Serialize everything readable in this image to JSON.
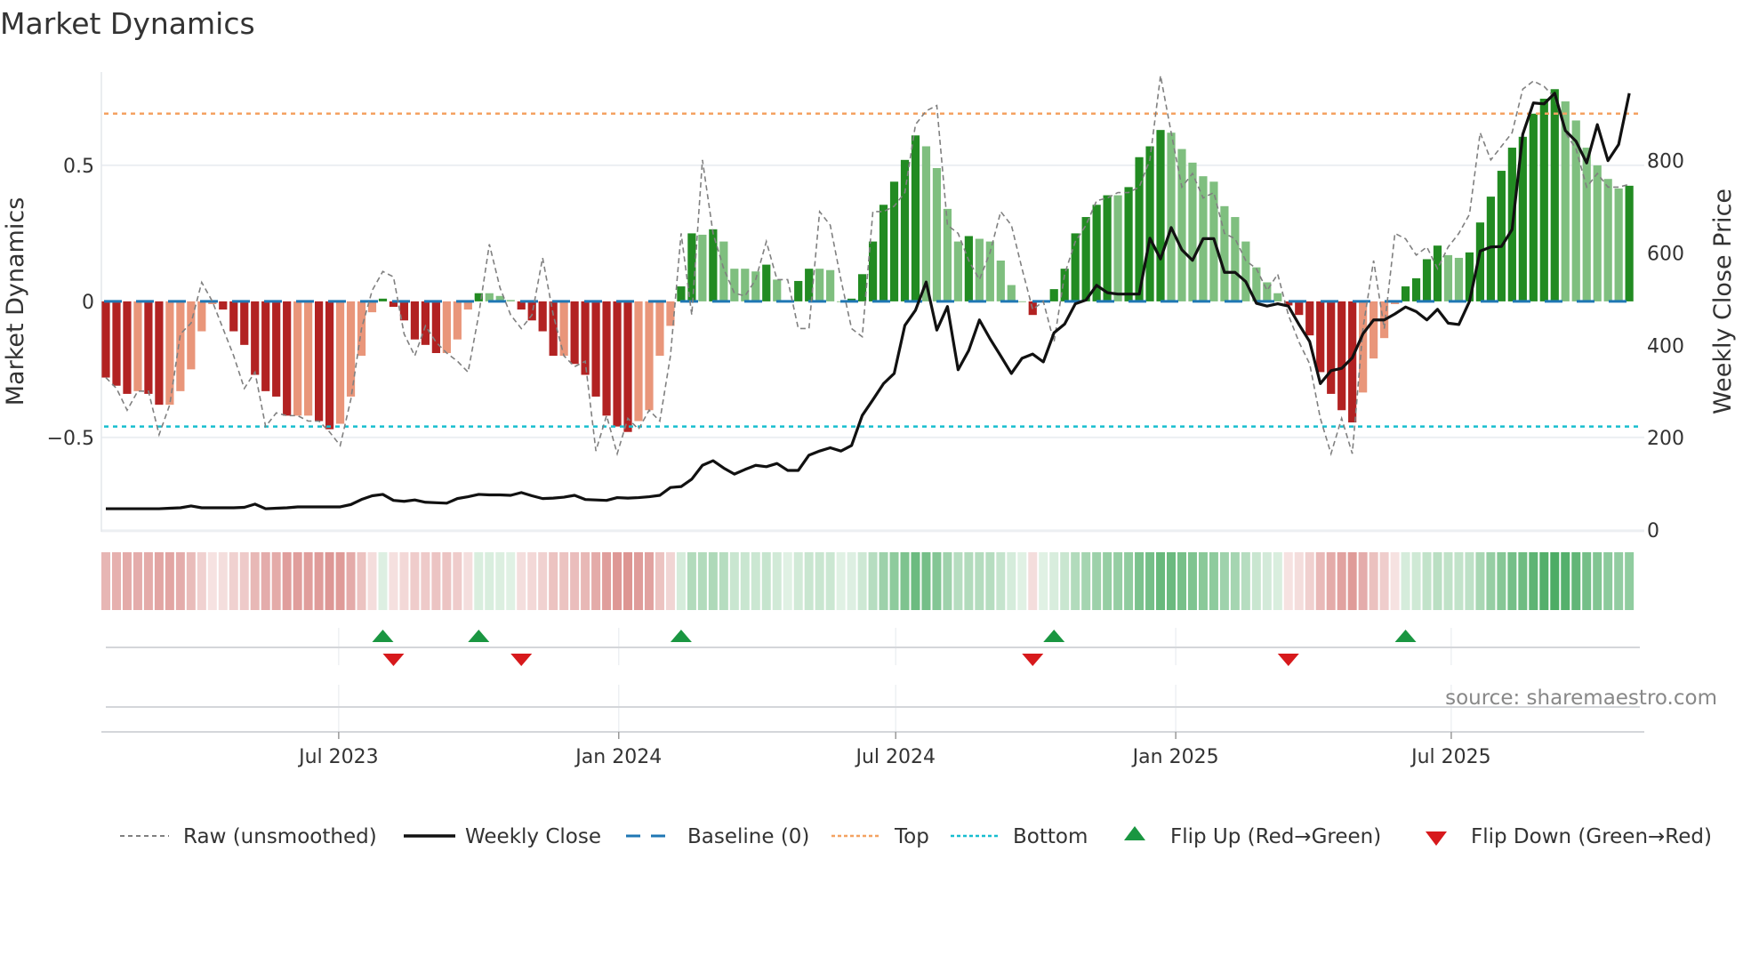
{
  "title": "Market Dynamics",
  "source": "source: sharemaestro.com",
  "colors": {
    "dark_red": "#b22222",
    "light_red": "#e9967a",
    "dark_green": "#228b22",
    "light_green": "#7fbf7f",
    "raw": "#808080",
    "close": "#111111",
    "baseline": "#1f77b4",
    "top": "#f4a261",
    "bottom": "#17becf",
    "flip_up": "#1a9641",
    "flip_down": "#d7191c"
  },
  "chart_data": {
    "type": "bar",
    "title": "Market Dynamics",
    "ylabel": "Market Dynamics",
    "y2label": "Weekly Close Price",
    "ylim": [
      -0.847,
      0.843
    ],
    "y2lim": [
      -4,
      992
    ],
    "yticks": [
      {
        "value": -0.5,
        "label": "−0.5"
      },
      {
        "value": 0,
        "label": "0"
      },
      {
        "value": 0.5,
        "label": "0.5"
      }
    ],
    "y2ticks": [
      {
        "value": 0,
        "label": "0"
      },
      {
        "value": 200,
        "label": "200"
      },
      {
        "value": 400,
        "label": "400"
      },
      {
        "value": 600,
        "label": "600"
      },
      {
        "value": 800,
        "label": "800"
      }
    ],
    "xticks": [
      {
        "date": "2023-07-01",
        "label": "Jul 2023"
      },
      {
        "date": "2024-01-01",
        "label": "Jan 2024"
      },
      {
        "date": "2024-07-01",
        "label": "Jul 2024"
      },
      {
        "date": "2025-01-01",
        "label": "Jan 2025"
      },
      {
        "date": "2025-07-01",
        "label": "Jul 2025"
      }
    ],
    "start_date": "2023-01-29",
    "frequency": "weekly",
    "baseline": 0,
    "top": 0.69,
    "bottom": -0.46,
    "series": [
      {
        "name": "Market Dynamics",
        "values": [
          -0.28,
          -0.31,
          -0.34,
          -0.33,
          -0.34,
          -0.38,
          -0.38,
          -0.33,
          -0.25,
          -0.11,
          -0.01,
          -0.03,
          -0.11,
          -0.16,
          -0.27,
          -0.33,
          -0.35,
          -0.42,
          -0.42,
          -0.42,
          -0.44,
          -0.47,
          -0.45,
          -0.35,
          -0.2,
          -0.04,
          0.01,
          -0.02,
          -0.07,
          -0.14,
          -0.16,
          -0.19,
          -0.19,
          -0.14,
          -0.03,
          0.03,
          0.03,
          0.02,
          0.005,
          -0.03,
          -0.07,
          -0.11,
          -0.2,
          -0.2,
          -0.23,
          -0.27,
          -0.35,
          -0.42,
          -0.46,
          -0.48,
          -0.44,
          -0.4,
          -0.2,
          -0.09,
          0.055,
          0.25,
          0.245,
          0.265,
          0.22,
          0.12,
          0.12,
          0.11,
          0.135,
          0.08,
          0,
          0.075,
          0.12,
          0.12,
          0.115,
          0,
          0.01,
          0.1,
          0.22,
          0.355,
          0.44,
          0.52,
          0.61,
          0.57,
          0.49,
          0.34,
          0.22,
          0.24,
          0.23,
          0.22,
          0.15,
          0.06,
          0,
          -0.05,
          0,
          0.045,
          0.12,
          0.25,
          0.31,
          0.355,
          0.39,
          0.39,
          0.42,
          0.53,
          0.57,
          0.63,
          0.62,
          0.56,
          0.51,
          0.46,
          0.44,
          0.35,
          0.31,
          0.22,
          0.125,
          0.07,
          0.03,
          -0.015,
          -0.05,
          -0.125,
          -0.26,
          -0.34,
          -0.4,
          -0.445,
          -0.335,
          -0.21,
          -0.135,
          -0.01,
          0.055,
          0.085,
          0.155,
          0.205,
          0.17,
          0.16,
          0.18,
          0.29,
          0.385,
          0.48,
          0.565,
          0.605,
          0.69,
          0.745,
          0.78,
          0.735,
          0.665,
          0.565,
          0.5,
          0.45,
          0.415,
          0.425
        ]
      },
      {
        "name": "Raw (unsmoothed)",
        "values": [
          -0.28,
          -0.32,
          -0.4,
          -0.33,
          -0.33,
          -0.49,
          -0.38,
          -0.12,
          -0.08,
          0.07,
          0.0,
          -0.1,
          -0.2,
          -0.32,
          -0.26,
          -0.46,
          -0.41,
          -0.42,
          -0.42,
          -0.44,
          -0.44,
          -0.48,
          -0.53,
          -0.36,
          -0.1,
          0.04,
          0.11,
          0.09,
          -0.12,
          -0.2,
          -0.09,
          -0.15,
          -0.19,
          -0.22,
          -0.26,
          -0.05,
          0.21,
          0.05,
          -0.05,
          -0.1,
          -0.05,
          0.16,
          -0.05,
          -0.2,
          -0.24,
          -0.22,
          -0.55,
          -0.42,
          -0.56,
          -0.43,
          -0.47,
          -0.4,
          -0.44,
          -0.2,
          0.25,
          -0.05,
          0.52,
          0.25,
          0.12,
          0.03,
          0.02,
          0.08,
          0.22,
          0.08,
          0.08,
          -0.1,
          -0.1,
          0.33,
          0.28,
          0.08,
          -0.1,
          -0.13,
          0.33,
          0.33,
          0.35,
          0.4,
          0.65,
          0.7,
          0.72,
          0.28,
          0.25,
          0.15,
          0.08,
          0.18,
          0.33,
          0.28,
          0.12,
          -0.03,
          0.0,
          -0.15,
          0.1,
          0.22,
          0.28,
          0.37,
          0.38,
          0.4,
          0.4,
          0.42,
          0.52,
          0.83,
          0.62,
          0.42,
          0.47,
          0.38,
          0.4,
          0.25,
          0.23,
          0.15,
          0.12,
          0.04,
          0.1,
          -0.05,
          -0.15,
          -0.23,
          -0.43,
          -0.56,
          -0.43,
          -0.56,
          -0.1,
          0.15,
          -0.1,
          0.25,
          0.23,
          0.17,
          0.2,
          0.12,
          0.2,
          0.25,
          0.32,
          0.62,
          0.52,
          0.57,
          0.62,
          0.78,
          0.81,
          0.79,
          0.75,
          0.62,
          0.56,
          0.42,
          0.47,
          0.42,
          0.42,
          0.43
        ]
      },
      {
        "name": "Weekly Close",
        "axis": "right",
        "values": [
          46,
          46,
          46,
          46,
          46,
          46,
          47,
          48,
          52,
          48,
          48,
          48,
          48,
          49,
          56,
          46,
          47,
          48,
          50,
          50,
          50,
          50,
          50,
          55,
          66,
          74,
          77,
          64,
          62,
          65,
          60,
          59,
          58,
          68,
          72,
          77,
          76,
          76,
          75,
          81,
          74,
          68,
          69,
          71,
          75,
          66,
          65,
          64,
          70,
          69,
          70,
          72,
          75,
          92,
          94,
          110,
          140,
          150,
          134,
          121,
          131,
          140,
          137,
          144,
          129,
          129,
          162,
          171,
          178,
          171,
          183,
          248,
          282,
          317,
          339,
          443,
          476,
          537,
          433,
          484,
          347,
          389,
          455,
          414,
          377,
          339,
          372,
          381,
          364,
          427,
          446,
          490,
          498,
          530,
          514,
          511,
          511,
          511,
          632,
          587,
          655,
          607,
          584,
          631,
          631,
          558,
          558,
          538,
          491,
          485,
          490,
          485,
          445,
          408,
          317,
          345,
          350,
          373,
          425,
          455,
          455,
          468,
          483,
          473,
          455,
          478,
          448,
          445,
          495,
          604,
          613,
          614,
          651,
          857,
          925,
          923,
          946,
          865,
          842,
          795,
          878,
          800,
          835,
          946
        ]
      }
    ],
    "flips_up_index": [
      26,
      35,
      54,
      89,
      122
    ],
    "flips_down_index": [
      27,
      39,
      87,
      111
    ],
    "legend": [
      "Raw (unsmoothed)",
      "Weekly Close",
      "Baseline (0)",
      "Top",
      "Bottom",
      "Flip Up (Red→Green)",
      "Flip Down (Green→Red)"
    ],
    "legend_position": "bottom"
  }
}
